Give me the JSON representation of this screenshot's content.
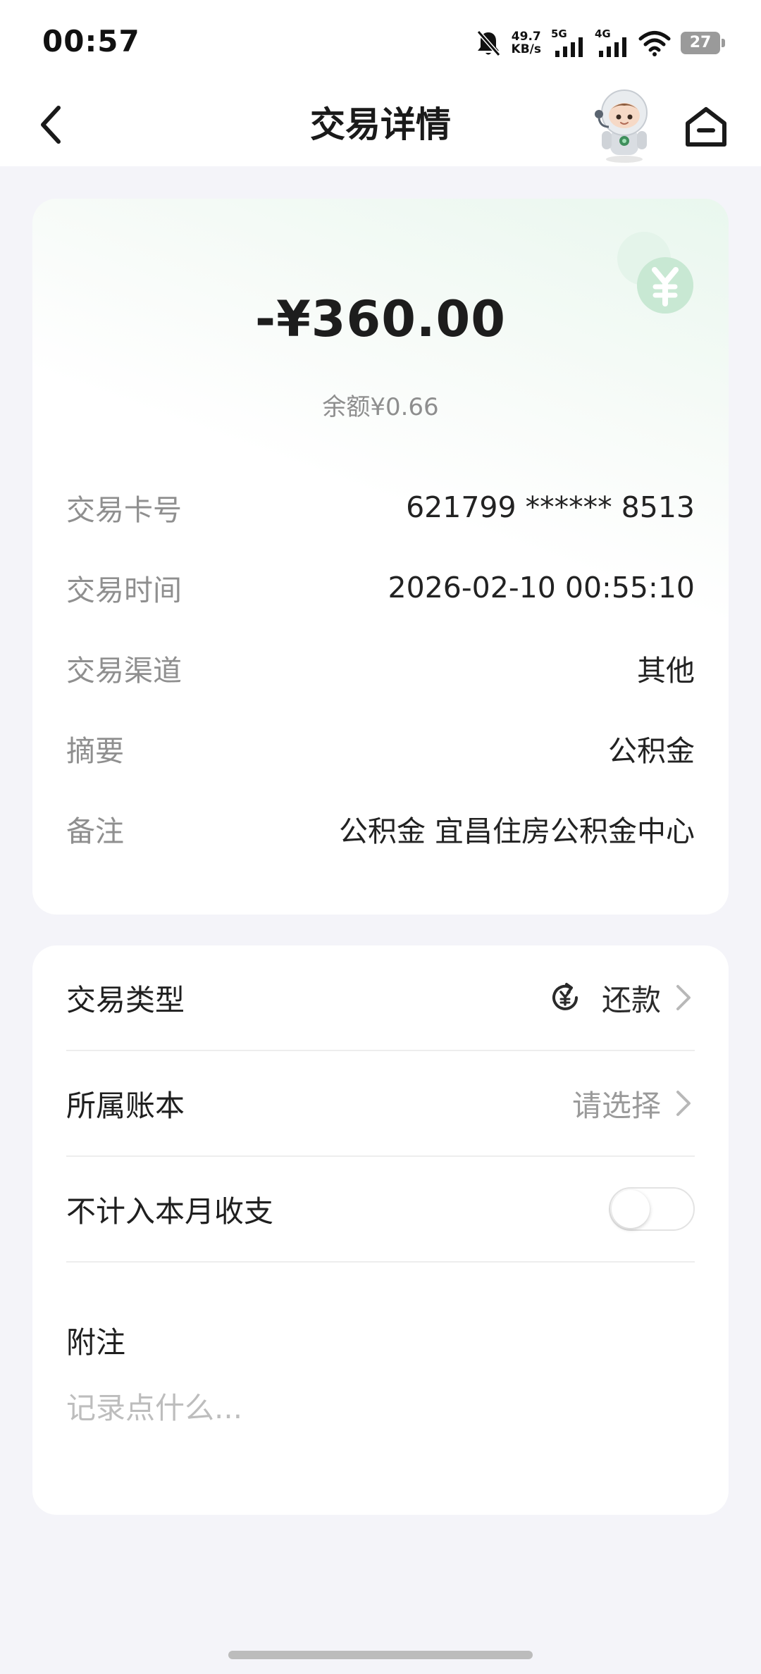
{
  "status_bar": {
    "time": "00:57",
    "net_speed_value": "49.7",
    "net_speed_unit": "KB/s",
    "sim1_tag": "5G",
    "sim2_tag": "4G",
    "battery": "27"
  },
  "nav": {
    "title": "交易详情"
  },
  "transaction": {
    "amount": "-¥360.00",
    "balance": "余额¥0.66",
    "rows": [
      {
        "label": "交易卡号",
        "value": "621799 ****** 8513"
      },
      {
        "label": "交易时间",
        "value": "2026-02-10 00:55:10"
      },
      {
        "label": "交易渠道",
        "value": "其他"
      },
      {
        "label": "摘要",
        "value": "公积金"
      },
      {
        "label": "备注",
        "value": "公积金 宜昌住房公积金中心"
      }
    ]
  },
  "settings": {
    "type_label": "交易类型",
    "type_value": "还款",
    "ledger_label": "所属账本",
    "ledger_placeholder": "请选择",
    "exclude_label": "不计入本月收支",
    "exclude_on": false,
    "memo_label": "附注",
    "memo_placeholder": "记录点什么..."
  },
  "colors": {
    "accent_green": "#5cbf86",
    "background": "#f4f4f9"
  }
}
